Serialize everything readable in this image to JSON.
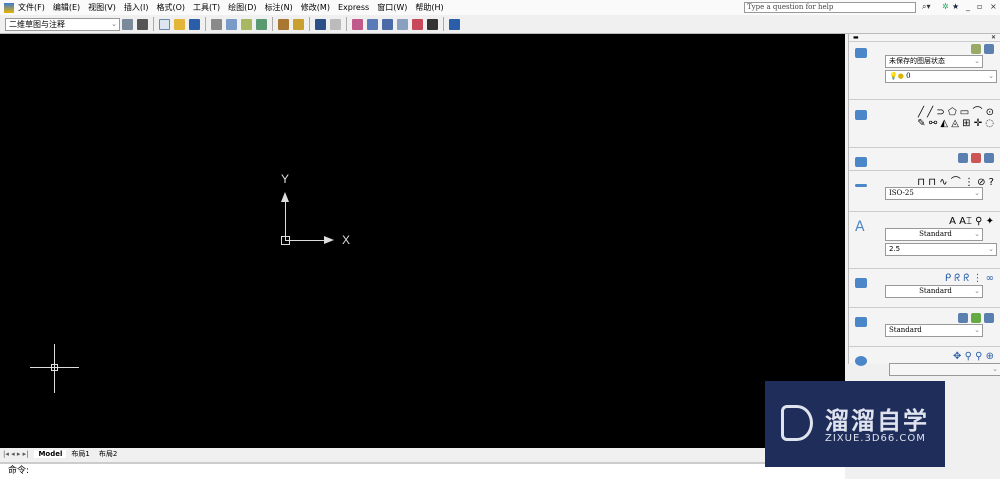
{
  "menu": [
    "文件(F)",
    "编辑(E)",
    "视图(V)",
    "插入(I)",
    "格式(O)",
    "工具(T)",
    "绘图(D)",
    "标注(N)",
    "修改(M)",
    "Express",
    "窗口(W)",
    "帮助(H)"
  ],
  "help_placeholder": "Type a question for help",
  "workspace": "二维草图与注释",
  "canvas": {
    "y_label": "Y",
    "x_label": "X"
  },
  "tabs": [
    "Model",
    "布局1",
    "布局2"
  ],
  "command_prompt": "命令:",
  "panel": {
    "layer_state": "未保存的图层状态",
    "layer": "0",
    "dim_style": "ISO-25",
    "text_style": "Standard",
    "text_height": "2.5",
    "mleader_style": "Standard",
    "table_style": "Standard"
  },
  "watermark": {
    "name": "溜溜自学",
    "url": "ZIXUE.3D66.COM"
  }
}
